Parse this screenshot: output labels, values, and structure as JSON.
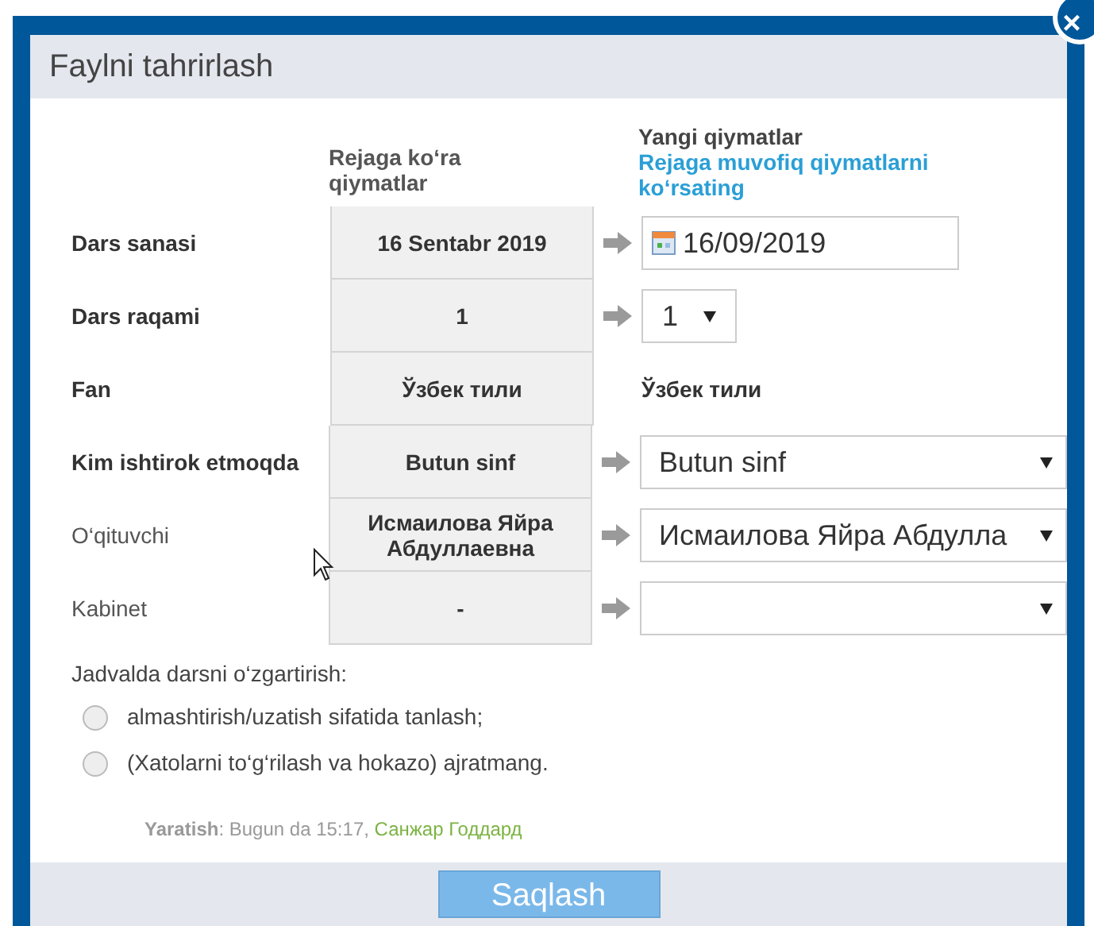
{
  "dialog": {
    "title": "Faylni tahrirlash",
    "close_label": "×"
  },
  "columns": {
    "plan": "Rejaga ko‘ra qiymatlar",
    "new": "Yangi qiymatlar",
    "new_link": "Rejaga muvofiq qiymatlarni ko‘rsating"
  },
  "rows": [
    {
      "label": "Dars sanasi",
      "required": true,
      "plan": "16 Sentabr 2019",
      "kind": "date",
      "value": "16/09/2019"
    },
    {
      "label": "Dars raqami",
      "required": true,
      "plan": "1",
      "kind": "small-select",
      "value": "1"
    },
    {
      "label": "Fan",
      "required": true,
      "plan": "Ўзбек тили",
      "kind": "text",
      "value": "Ўзбек тили"
    },
    {
      "label": "Kim ishtirok etmoqda",
      "required": true,
      "plan": "Butun sinf",
      "kind": "select",
      "value": "Butun sinf"
    },
    {
      "label": "O‘qituvchi",
      "required": false,
      "plan": "Исмаилова Яйра Абдуллаевна",
      "kind": "select",
      "value": "Исмаилова Яйра Абдулла"
    },
    {
      "label": "Kabinet",
      "required": false,
      "plan": "-",
      "kind": "select"
    }
  ],
  "change": {
    "label": "Jadvalda darsni o‘zgartirish:",
    "options": [
      {
        "label": "almashtirish/uzatish sifatida tanlash;",
        "selected": false
      },
      {
        "label": "(Xatolarni to‘g‘rilash va hokazo) ajratmang.",
        "selected": false
      }
    ]
  },
  "created": {
    "label": "Yaratish",
    "text": ": Bugun da 15:17, ",
    "author": "Санжар Годдард"
  },
  "save_button": "Saqlash"
}
